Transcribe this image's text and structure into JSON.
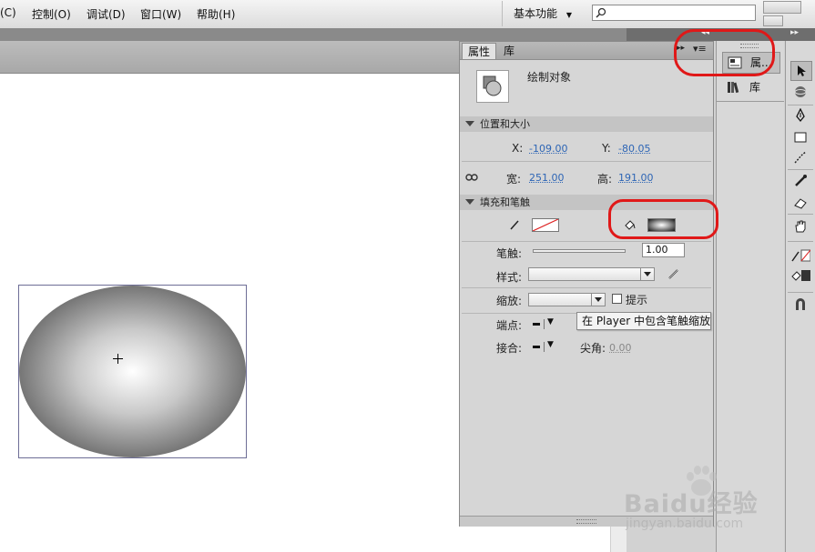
{
  "menu": {
    "items": [
      "(C)",
      "控制(O)",
      "调试(D)",
      "窗口(W)",
      "帮助(H)"
    ],
    "workspace_label": "基本功能",
    "search_placeholder": ""
  },
  "panel": {
    "tabs": [
      "属性",
      "库"
    ],
    "object_type": "绘制对象",
    "position_section": "位置和大小",
    "x_label": "X:",
    "x_value": "-109.00",
    "y_label": "Y:",
    "y_value": "-80.05",
    "w_label": "宽:",
    "w_value": "251.00",
    "h_label": "高:",
    "h_value": "191.00",
    "fill_section": "填充和笔触",
    "stroke_label": "笔触:",
    "stroke_value": "1.00",
    "style_label": "样式:",
    "scale_label": "缩放:",
    "hint_label": "提示",
    "cap_label": "端点:",
    "join_label": "接合:",
    "miter_label": "尖角:",
    "miter_value": "0.00"
  },
  "tooltip": "在 Player 中包含笔触缩放",
  "collapsed_panels": [
    {
      "label": "属...",
      "icon": "properties-icon"
    },
    {
      "label": "库",
      "icon": "library-icon"
    }
  ],
  "watermark": {
    "brand": "Baidu经验",
    "url": "jingyan.baidu.com"
  },
  "colors": {
    "highlight": "#e01818",
    "link_value": "#2d65b5"
  }
}
